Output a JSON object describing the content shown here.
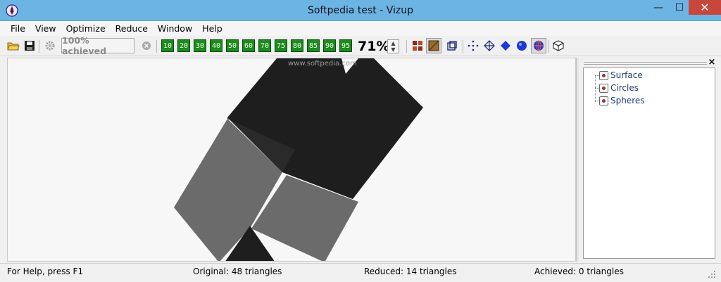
{
  "window": {
    "title": "Softpedia test - Vizup",
    "minimize": "—",
    "maximize": "☐",
    "close": "✕"
  },
  "menu": [
    "File",
    "View",
    "Optimize",
    "Reduce",
    "Window",
    "Help"
  ],
  "toolbar": {
    "achieved_label": "100% achieved",
    "percent_buttons": [
      "10",
      "20",
      "30",
      "40",
      "50",
      "60",
      "70",
      "75",
      "80",
      "85",
      "90",
      "95"
    ],
    "zoom": "71%",
    "spin_up": "▲",
    "spin_down": "▼"
  },
  "viewport": {
    "watermark": "www.softpedia.com"
  },
  "panel": {
    "close": "×",
    "tree": [
      "Surface",
      "Circles",
      "Spheres"
    ]
  },
  "status": {
    "help": "For Help, press F1",
    "original": "Original: 48 triangles",
    "reduced": "Reduced: 14 triangles",
    "achieved": "Achieved: 0 triangles"
  },
  "colors": {
    "titlebar": "#6cb4e4",
    "close_button": "#c7473c",
    "percent_button": "#1d8a1d",
    "dark_face": "#1e1e1e",
    "light_face": "#6b6b6b"
  }
}
